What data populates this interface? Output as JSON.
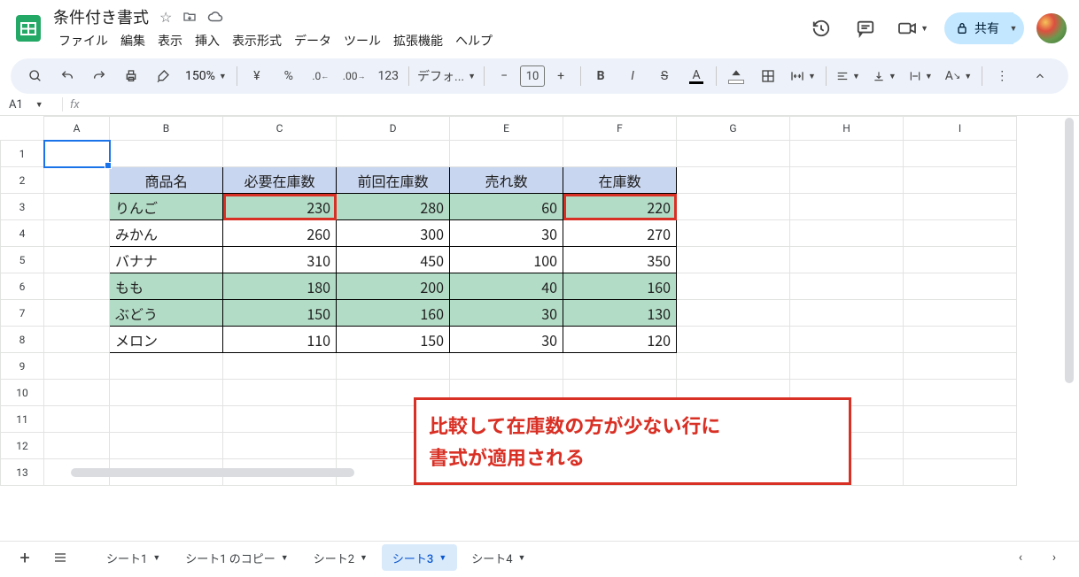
{
  "doc": {
    "title": "条件付き書式"
  },
  "menus": [
    "ファイル",
    "編集",
    "表示",
    "挿入",
    "表示形式",
    "データ",
    "ツール",
    "拡張機能",
    "ヘルプ"
  ],
  "toolbar": {
    "zoom": "150%",
    "currency": "¥",
    "font": "デフォ...",
    "size": "10"
  },
  "share": {
    "label": "共有"
  },
  "name_box": "A1",
  "columns": [
    "A",
    "B",
    "C",
    "D",
    "E",
    "F",
    "G",
    "H",
    "I"
  ],
  "rows": [
    "1",
    "2",
    "3",
    "4",
    "5",
    "6",
    "7",
    "8",
    "9",
    "10",
    "11",
    "12",
    "13"
  ],
  "table": {
    "head": [
      "商品名",
      "必要在庫数",
      "前回在庫数",
      "売れ数",
      "在庫数"
    ],
    "rows": [
      {
        "name": "りんご",
        "req": 230,
        "prev": 280,
        "sold": 60,
        "stock": 220,
        "hl": true,
        "box": true
      },
      {
        "name": "みかん",
        "req": 260,
        "prev": 300,
        "sold": 30,
        "stock": 270,
        "hl": false
      },
      {
        "name": "バナナ",
        "req": 310,
        "prev": 450,
        "sold": 100,
        "stock": 350,
        "hl": false
      },
      {
        "name": "もも",
        "req": 180,
        "prev": 200,
        "sold": 40,
        "stock": 160,
        "hl": true
      },
      {
        "name": "ぶどう",
        "req": 150,
        "prev": 160,
        "sold": 30,
        "stock": 130,
        "hl": true
      },
      {
        "name": "メロン",
        "req": 110,
        "prev": 150,
        "sold": 30,
        "stock": 120,
        "hl": false
      }
    ]
  },
  "annotation": {
    "l1": "比較して在庫数の方が少ない行に",
    "l2": "書式が適用される"
  },
  "tabs": {
    "items": [
      "シート1",
      "シート1 のコピー",
      "シート2",
      "シート3",
      "シート4"
    ],
    "active": 3
  }
}
